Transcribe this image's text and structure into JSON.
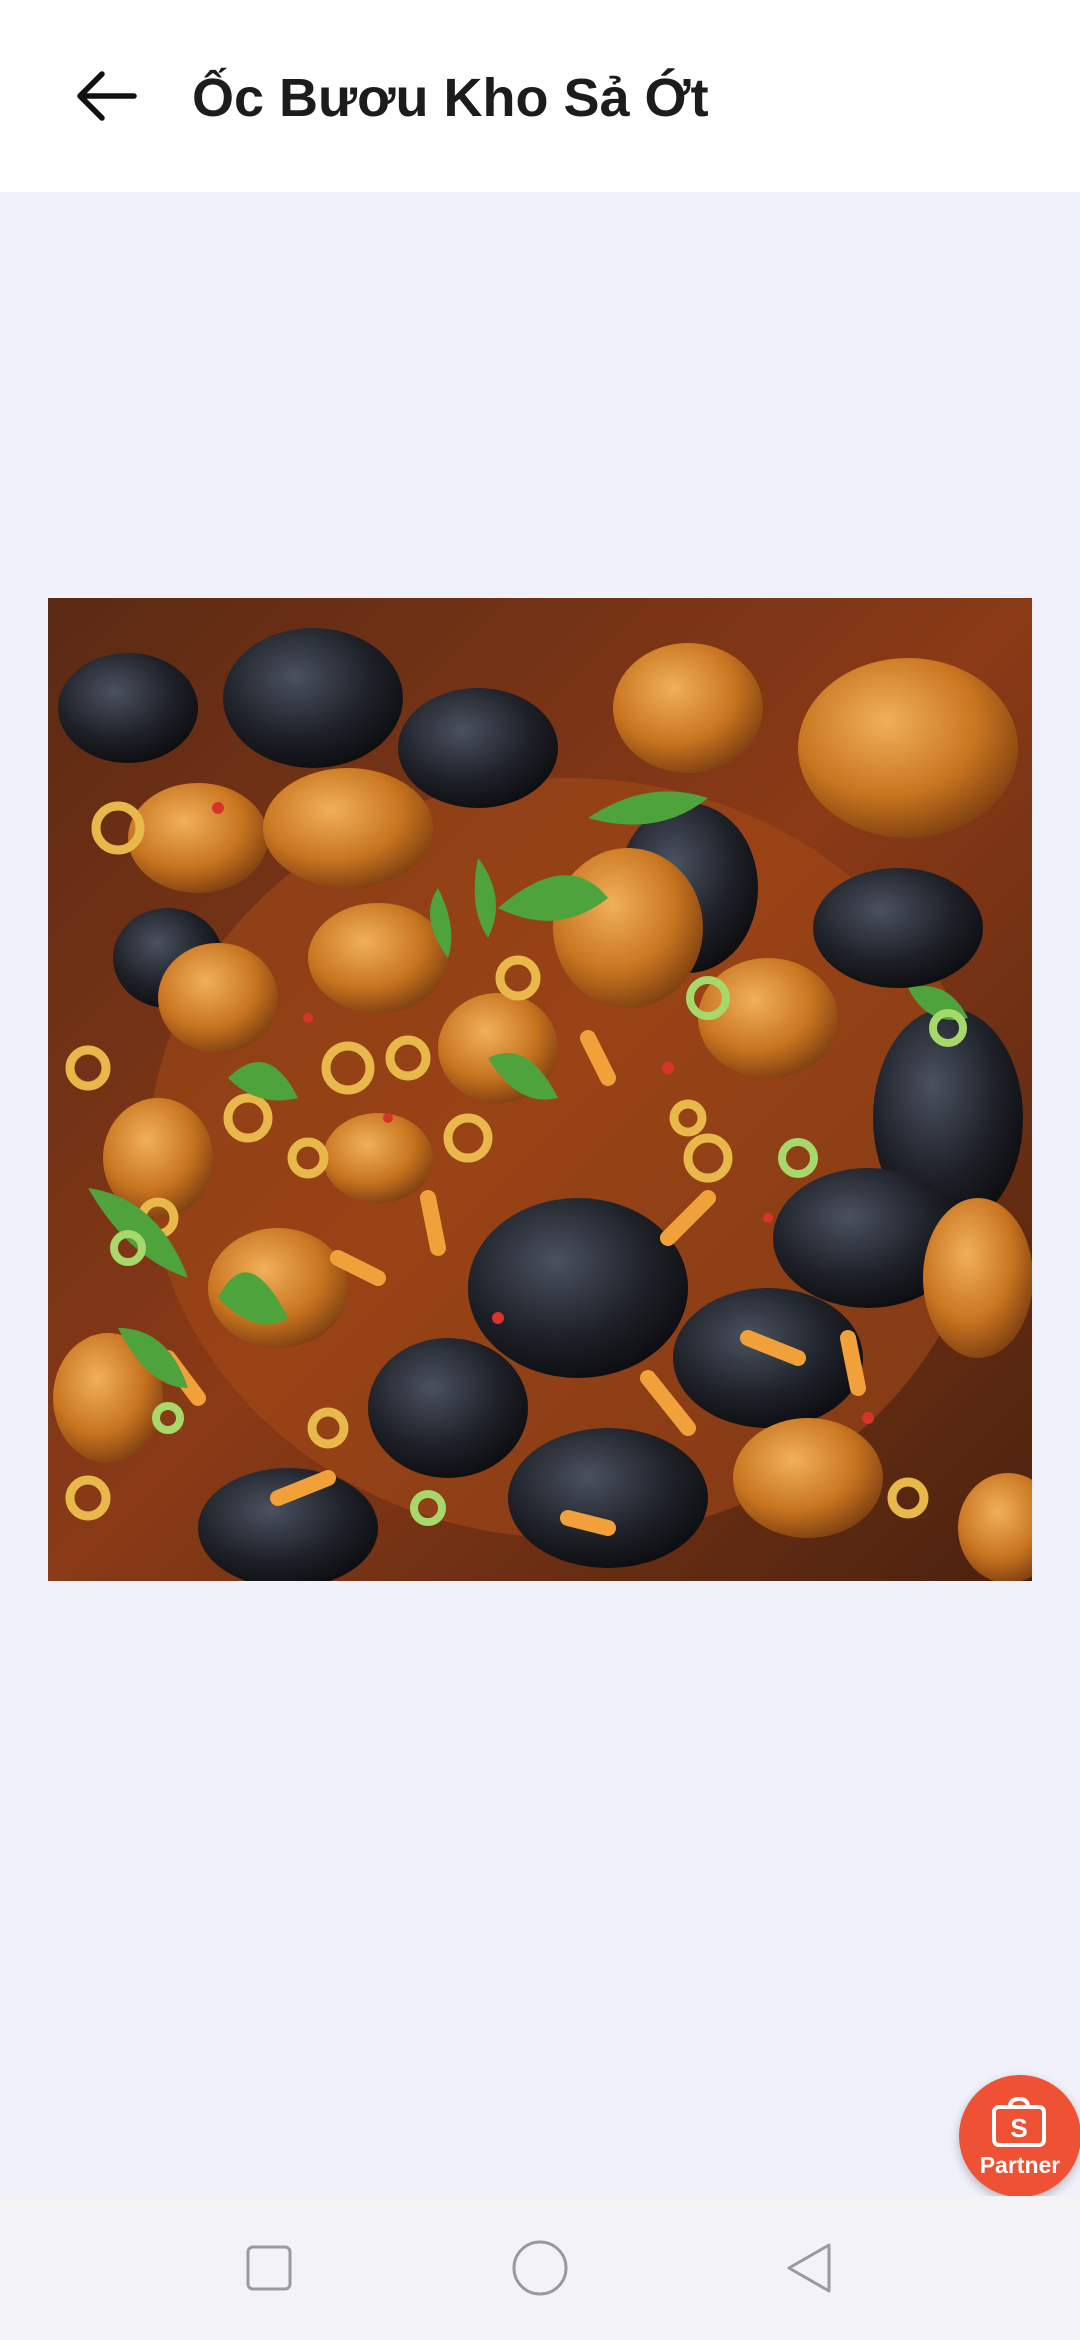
{
  "header": {
    "title": "Ốc Bươu Kho Sả Ớt",
    "back_icon": "arrow-left-icon"
  },
  "main": {
    "image_subject": "braised apple snails with lemongrass, chili, scallions and herbs",
    "image_icon": "dish-photo"
  },
  "fab": {
    "label": "Partner",
    "icon": "shopping-bag-s-icon",
    "color": "#ef5134"
  },
  "navbar": {
    "recents_icon": "square-icon",
    "home_icon": "circle-icon",
    "back_icon": "triangle-back-icon"
  },
  "colors": {
    "background": "#f0f1fa",
    "header": "#ffffff",
    "navbar": "#f3f3f5",
    "title_text": "#1c1c1c"
  }
}
